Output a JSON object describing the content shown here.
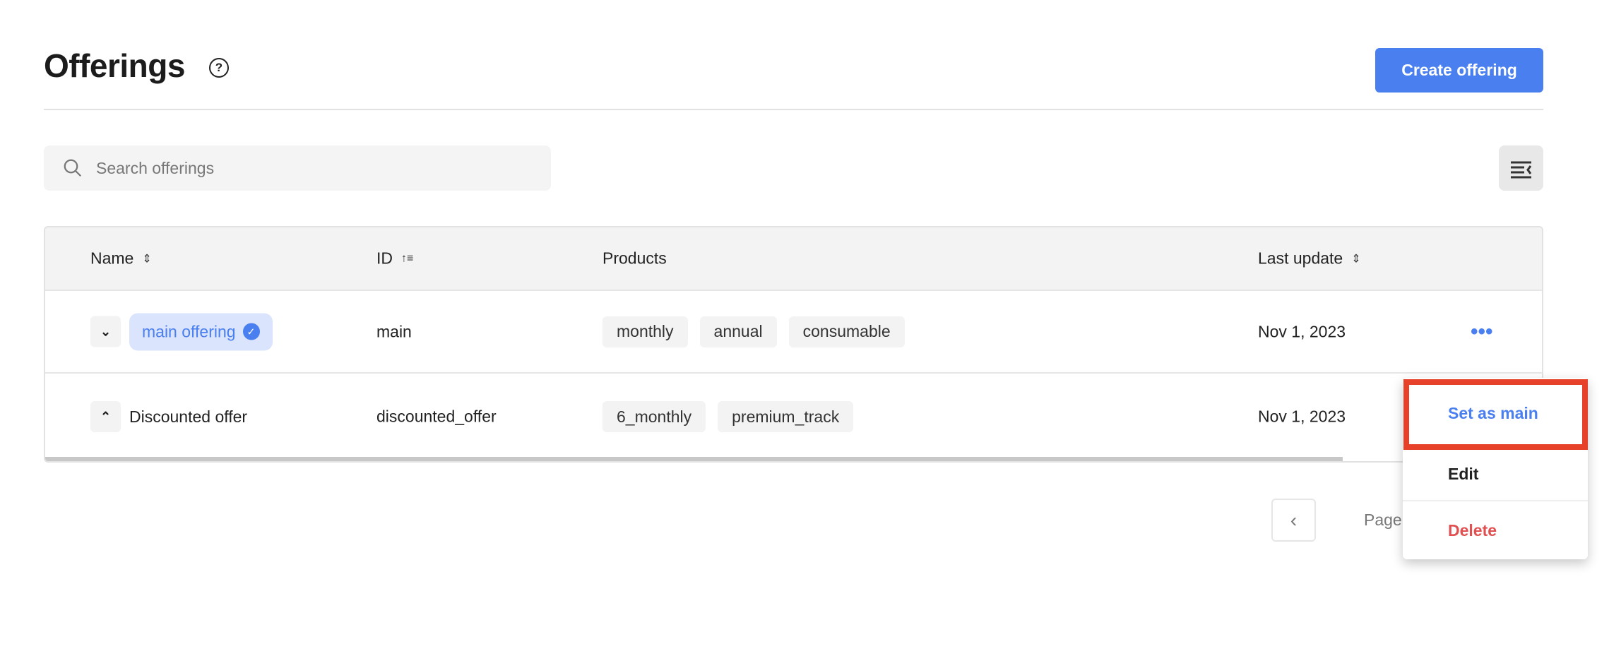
{
  "header": {
    "title": "Offerings",
    "help_icon": "question-circle-icon",
    "create_label": "Create offering"
  },
  "search": {
    "placeholder": "Search offerings",
    "value": ""
  },
  "table": {
    "columns": [
      {
        "label": "Name",
        "sort": "unsorted"
      },
      {
        "label": "ID",
        "sort": "ascending"
      },
      {
        "label": "Products"
      },
      {
        "label": "Last update",
        "sort": "unsorted"
      }
    ],
    "rows": [
      {
        "name": "main offering",
        "is_main": true,
        "expanded": false,
        "id": "main",
        "products": [
          "monthly",
          "annual",
          "consumable"
        ],
        "last_update": "Nov 1, 2023"
      },
      {
        "name": "Discounted offer",
        "is_main": false,
        "expanded": true,
        "id": "discounted_offer",
        "products": [
          "6_monthly",
          "premium_track"
        ],
        "last_update": "Nov 1, 2023"
      }
    ]
  },
  "pagination": {
    "page_label": "Page"
  },
  "context_menu": {
    "items": [
      {
        "label": "Set as main",
        "color": "#4a7ff0",
        "highlighted": true
      },
      {
        "label": "Edit",
        "color": "#222222"
      },
      {
        "label": "Delete",
        "color": "#e05050"
      }
    ]
  },
  "colors": {
    "accent": "#4a7ff0",
    "danger": "#e05050",
    "highlight": "#e8412a"
  }
}
